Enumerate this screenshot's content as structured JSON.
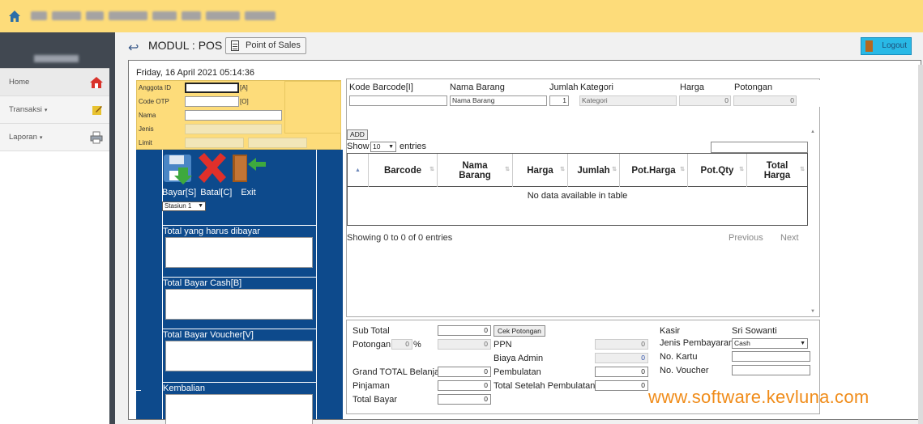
{
  "header": {
    "icon": "home-icon"
  },
  "sidebar": {
    "items": [
      {
        "label": "Home",
        "icon": "home-icon"
      },
      {
        "label": "Transaksi",
        "icon": "note-icon",
        "caret": "▾"
      },
      {
        "label": "Laporan",
        "icon": "printer-icon",
        "caret": "▾"
      }
    ]
  },
  "page": {
    "title": "MODUL : POS",
    "pos_button": "Point of Sales",
    "logout": "Logout",
    "datetime": "Friday, 16 April 2021 05:14:36"
  },
  "member": {
    "anggota_label": "Anggota ID",
    "anggota_hint": "[A]",
    "otp_label": "Code OTP",
    "otp_hint": "[O]",
    "nama_label": "Nama",
    "jenis_label": "Jenis",
    "limit_label": "Limit"
  },
  "actions": {
    "bayar": "Bayar[S]",
    "batal": "Batal[C]",
    "exit": "Exit",
    "stasiun_selected": "Stasiun 1"
  },
  "payments": {
    "total_harus": "Total yang harus dibayar",
    "cash": "Total Bayar Cash[B]",
    "voucher": "Total Bayar Voucher[V]",
    "kembalian": "Kembalian"
  },
  "product_form": {
    "kode_label": "Kode Barcode[I]",
    "nama_label": "Nama Barang",
    "nama_placeholder": "Nama Barang",
    "jumlah_label": "Jumlah",
    "jumlah_value": "1",
    "kategori_label": "Kategori",
    "kategori_placeholder": "Kategori",
    "harga_label": "Harga",
    "harga_value": "0",
    "potongan_label": "Potongan",
    "potongan_value": "0",
    "add_button": "ADD"
  },
  "table": {
    "show_label": "Show",
    "show_value": "10",
    "entries_label": "entries",
    "columns": [
      "",
      "Barcode",
      "Nama Barang",
      "Harga",
      "Jumlah",
      "Pot.Harga",
      "Pot.Qty",
      "Total Harga"
    ],
    "empty": "No data available in table",
    "showing": "Showing 0 to 0 of 0 entries",
    "previous": "Previous",
    "next": "Next"
  },
  "totals": {
    "subtotal_label": "Sub Total",
    "subtotal_value": "0",
    "cek_button": "Cek Potongan",
    "potongan_label": "Potongan",
    "potongan_pct": "0",
    "pct_sign": "%",
    "potongan_value": "0",
    "ppn_label": "PPN",
    "ppn_value": "0",
    "biaya_label": "Biaya Admin",
    "biaya_value": "0",
    "grand_label": "Grand TOTAL Belanja",
    "grand_value": "0",
    "pembulatan_label": "Pembulatan",
    "pembulatan_value": "0",
    "pinjaman_label": "Pinjaman",
    "pinjaman_value": "0",
    "setelah_label": "Total Setelah Pembulatan",
    "setelah_value": "0",
    "bayar_label": "Total Bayar",
    "bayar_value": "0",
    "kasir_label": "Kasir",
    "kasir_value": "Sri Sowanti",
    "jenis_label": "Jenis Pembayaran",
    "jenis_value": "Cash",
    "kartu_label": "No. Kartu",
    "voucher_label": "No. Voucher"
  },
  "watermark": "www.software.kevluna.com",
  "colors": {
    "header": "#fddc7a",
    "sidebar": "#414851",
    "blue_panel": "#0d4a8c",
    "watermark": "#f08c1a",
    "logout": "#29b9e6"
  }
}
